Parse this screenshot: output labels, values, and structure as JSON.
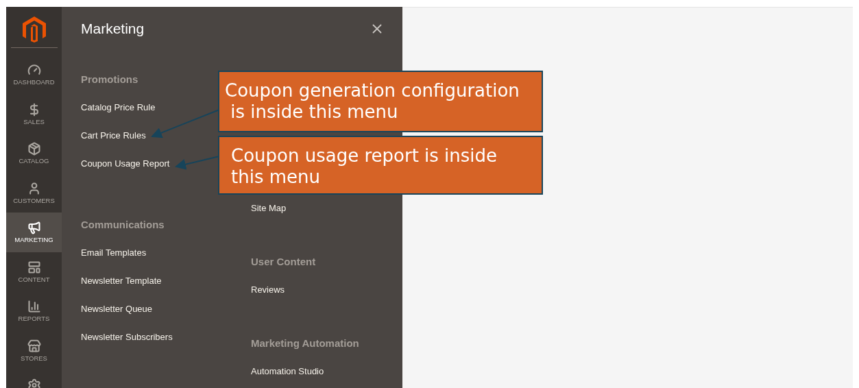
{
  "sidebar": {
    "items": [
      {
        "label": "DASHBOARD",
        "selected": false
      },
      {
        "label": "SALES",
        "selected": false
      },
      {
        "label": "CATALOG",
        "selected": false
      },
      {
        "label": "CUSTOMERS",
        "selected": false
      },
      {
        "label": "MARKETING",
        "selected": true
      },
      {
        "label": "CONTENT",
        "selected": false
      },
      {
        "label": "REPORTS",
        "selected": false
      },
      {
        "label": "STORES",
        "selected": false
      },
      {
        "selected": false
      }
    ]
  },
  "menu": {
    "title": "Marketing",
    "columns": [
      {
        "sections": [
          {
            "heading": "Promotions",
            "items": [
              "Catalog Price Rule",
              "Cart Price Rules",
              "Coupon Usage Report"
            ]
          },
          {
            "heading": "Communications",
            "items": [
              "Email Templates",
              "Newsletter Template",
              "Newsletter Queue",
              "Newsletter Subscribers"
            ]
          }
        ]
      },
      {
        "sections": [
          {
            "items": [
              "Site Map"
            ]
          },
          {
            "heading": "User Content",
            "items": [
              "Reviews"
            ]
          },
          {
            "heading": "Marketing Automation",
            "items": [
              "Automation Studio"
            ]
          }
        ]
      }
    ]
  },
  "callouts": [
    {
      "text": "Coupon generation configuration\n is inside this menu"
    },
    {
      "text": "Coupon usage report is inside\nthis menu"
    }
  ]
}
